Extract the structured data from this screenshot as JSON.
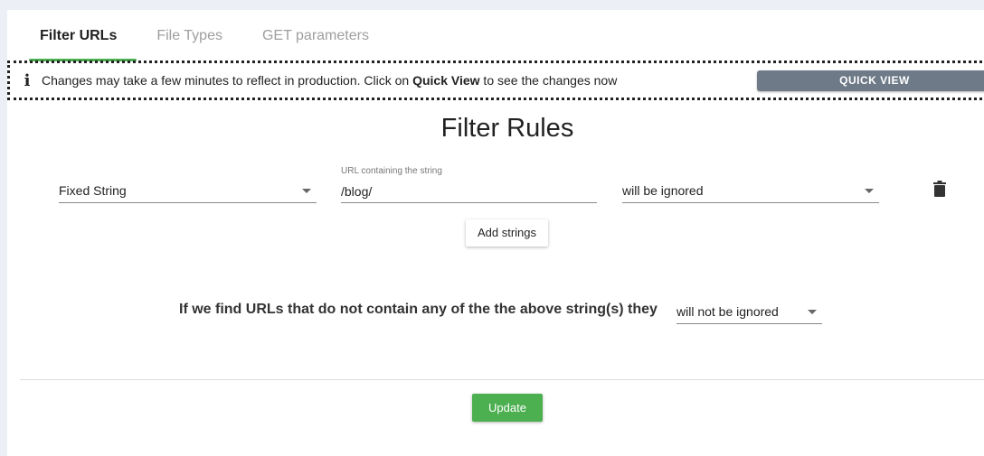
{
  "tabs": [
    {
      "label": "Filter URLs",
      "active": true
    },
    {
      "label": "File Types",
      "active": false
    },
    {
      "label": "GET parameters",
      "active": false
    }
  ],
  "banner": {
    "icon": "info-icon",
    "text_before": "Changes may take a few minutes to reflect in production. Click on ",
    "text_bold": "Quick View",
    "text_after": " to see the changes now",
    "button_label": "QUICK VIEW"
  },
  "title": "Filter Rules",
  "rule": {
    "match_type": "Fixed String",
    "url_label": "URL containing the string",
    "url_value": "/blog/",
    "action": "will be ignored",
    "delete_icon": "trash-icon"
  },
  "add_strings_label": "Add strings",
  "fallback": {
    "sentence": "If we find URLs that do not contain any of the the above string(s) they",
    "action": "will not be ignored"
  },
  "update_label": "Update",
  "colors": {
    "accent": "#4caf50",
    "quick_view_button": "#6e7a88",
    "page_background": "#eceff5"
  }
}
